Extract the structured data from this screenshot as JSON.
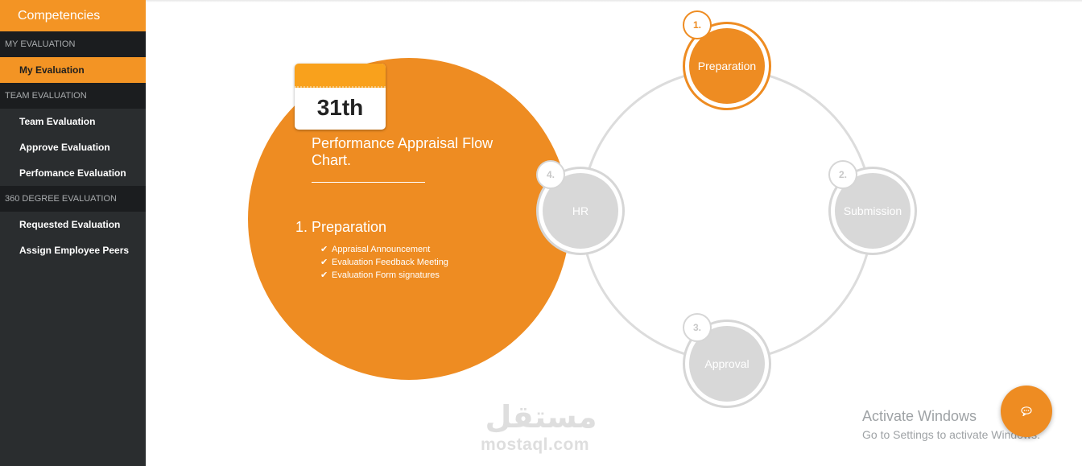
{
  "sidebar": {
    "title": "Competencies",
    "sections": [
      {
        "label": "MY EVALUATION"
      },
      {
        "label": "TEAM EVALUATION"
      },
      {
        "label": "360 DEGREE EVALUATION"
      }
    ],
    "items": {
      "my_evaluation": "My Evaluation",
      "team_evaluation": "Team Evaluation",
      "approve_evaluation": "Approve Evaluation",
      "performance_evaluation": "Perfomance Evaluation",
      "requested_evaluation": "Requested Evaluation",
      "assign_employee_peers": "Assign Employee Peers"
    },
    "active_item": "my_evaluation"
  },
  "flow": {
    "date_badge": "31th",
    "title": "Performance Appraisal Flow Chart.",
    "active_step_heading": "1. Preparation",
    "active_step_points": [
      "Appraisal Announcement",
      "Evaluation Feedback Meeting",
      "Evaluation Form signatures"
    ],
    "steps": [
      {
        "number": "1.",
        "label": "Preparation",
        "active": true
      },
      {
        "number": "2.",
        "label": "Submission",
        "active": false
      },
      {
        "number": "3.",
        "label": "Approval",
        "active": false
      },
      {
        "number": "4.",
        "label": "HR",
        "active": false
      }
    ],
    "accent_color": "#ee8c22"
  },
  "watermark": {
    "arabic": "مستقل",
    "latin": "mostaql.com"
  },
  "windows_notice": {
    "title": "Activate Windows",
    "subtitle": "Go to Settings to activate Windows."
  },
  "chat_button": {
    "icon": "chat-bubble-icon"
  }
}
